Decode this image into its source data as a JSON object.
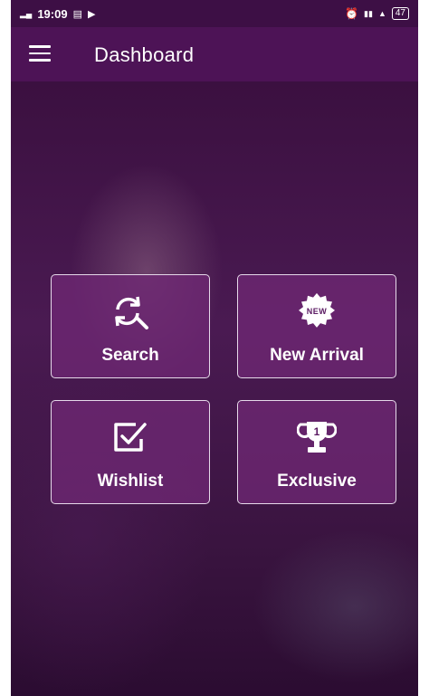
{
  "status_bar": {
    "time": "19:09",
    "battery": "47"
  },
  "app_bar": {
    "title": "Dashboard"
  },
  "tiles": [
    {
      "label": "Search",
      "icon": "search-refresh-icon"
    },
    {
      "label": "New Arrival",
      "icon": "new-badge-icon",
      "badge_text": "NEW"
    },
    {
      "label": "Wishlist",
      "icon": "checkbox-icon"
    },
    {
      "label": "Exclusive",
      "icon": "trophy-icon",
      "badge_text": "1"
    }
  ],
  "colors": {
    "app_bar": "#4d1356",
    "status_bar": "#3d0f45",
    "tile_fill": "#6e2873",
    "tile_border": "#e6d9ea"
  }
}
